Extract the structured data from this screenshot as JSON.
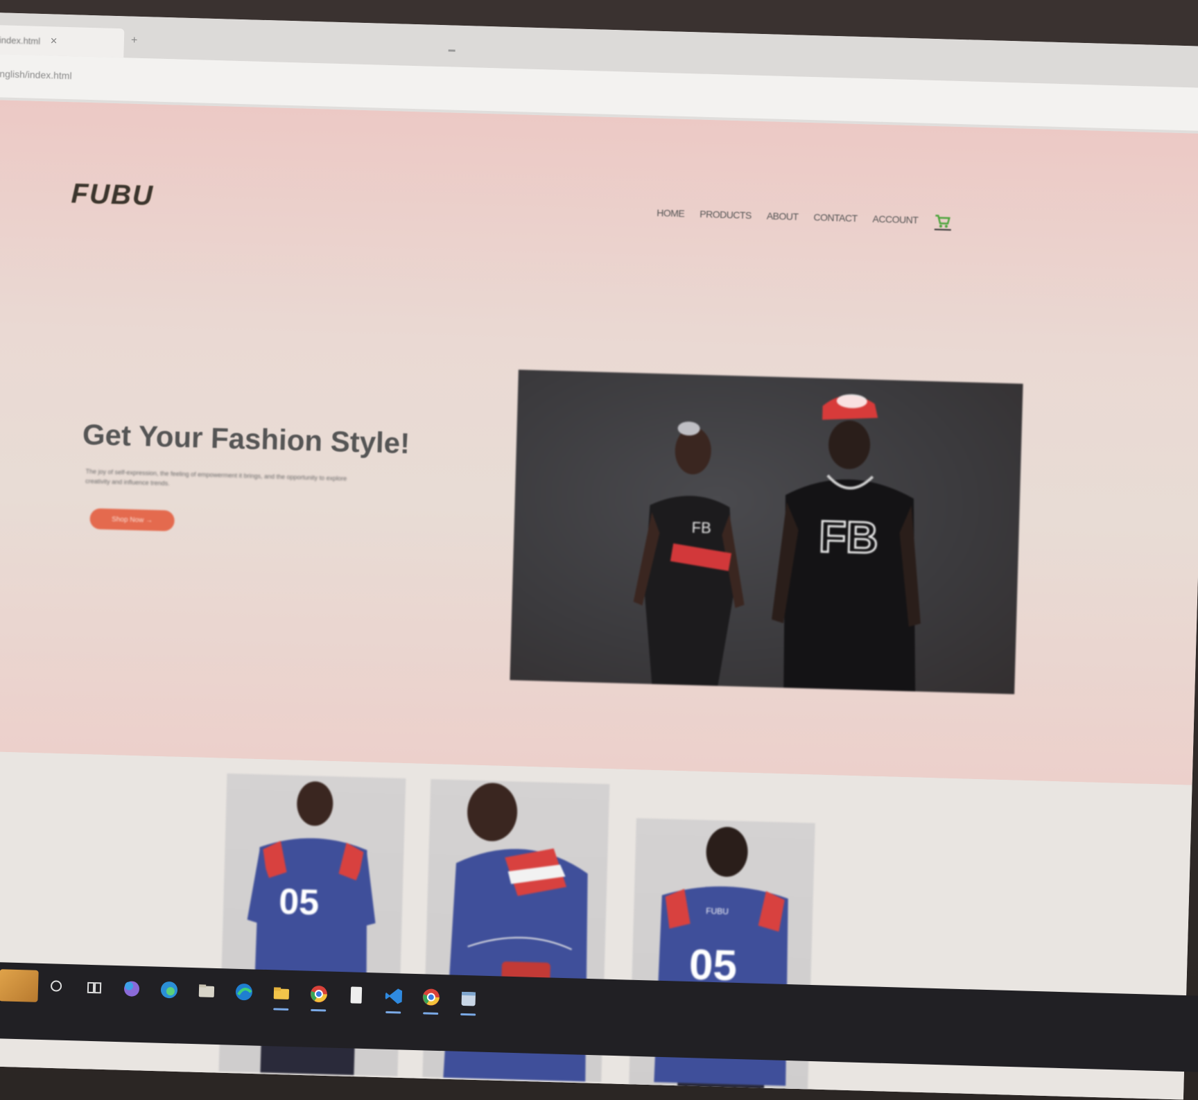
{
  "browser": {
    "tab_title": "index.html",
    "tab_close": "✕",
    "new_tab": "+",
    "url": "english/index.html"
  },
  "site": {
    "logo": "FUBU",
    "nav": [
      "HOME",
      "PRODUCTS",
      "ABOUT",
      "CONTACT",
      "ACCOUNT"
    ],
    "cart_icon": "shopping-cart-icon"
  },
  "hero": {
    "title": "Get Your Fashion Style!",
    "text": "The joy of self-expression, the feeling of empowerment it brings, and the opportunity to explore creativity and influence trends.",
    "button": "Shop Now →",
    "colors": {
      "accent": "#e46a4e",
      "hero_bg": "#ecc9c5"
    }
  },
  "products": {
    "jersey_number": "05",
    "back_lettering": "FUBU"
  },
  "taskbar": {
    "icons": [
      "search-icon",
      "task-view-icon",
      "copilot-icon",
      "edge-icon",
      "file-explorer-icon",
      "edge-icon",
      "folder-icon",
      "chrome-icon",
      "document-icon",
      "vscode-icon",
      "chrome-icon",
      "notepad-icon"
    ]
  }
}
